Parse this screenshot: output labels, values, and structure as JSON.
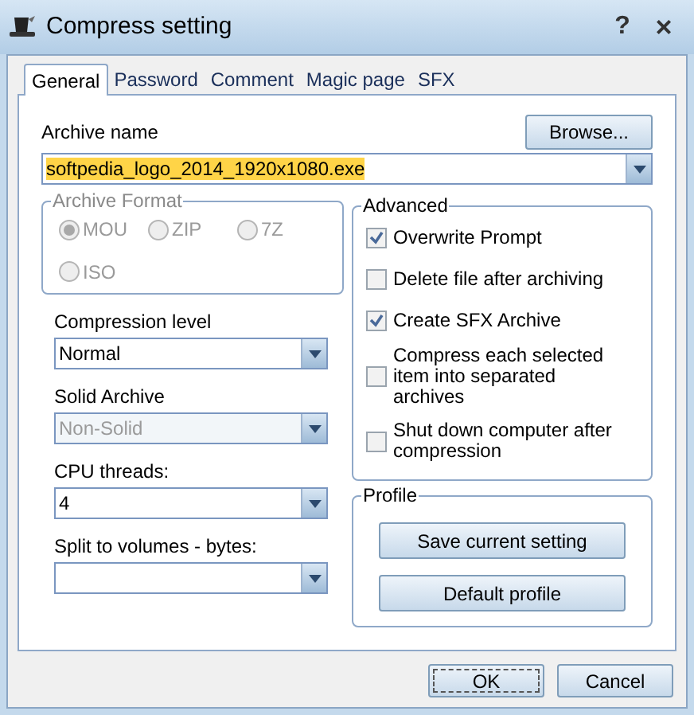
{
  "window": {
    "title": "Compress setting",
    "help": "?",
    "close": "×"
  },
  "tabs": [
    {
      "label": "General",
      "selected": true
    },
    {
      "label": "Password",
      "selected": false
    },
    {
      "label": "Comment",
      "selected": false
    },
    {
      "label": "Magic page",
      "selected": false
    },
    {
      "label": "SFX",
      "selected": false
    }
  ],
  "archive_name": {
    "label": "Archive name",
    "value": "softpedia_logo_2014_1920x1080.exe",
    "browse": "Browse..."
  },
  "archive_format": {
    "title": "Archive Format",
    "disabled": true,
    "options": [
      {
        "label": "MOU",
        "selected": true
      },
      {
        "label": "ZIP",
        "selected": false
      },
      {
        "label": "7Z",
        "selected": false
      },
      {
        "label": "ISO",
        "selected": false
      }
    ]
  },
  "settings": [
    {
      "label": "Compression level",
      "value": "Normal",
      "disabled": false
    },
    {
      "label": "Solid Archive",
      "value": "Non-Solid",
      "disabled": true
    },
    {
      "label": "CPU threads:",
      "value": "4",
      "disabled": false
    },
    {
      "label": "Split to volumes - bytes:",
      "disabled": false
    }
  ],
  "advanced": {
    "title": "Advanced",
    "options": [
      {
        "label": "Overwrite Prompt",
        "checked": true
      },
      {
        "label": "Delete file after archiving",
        "checked": false
      },
      {
        "label": "Create SFX Archive",
        "checked": true
      },
      {
        "label": "Compress each selected item into separated archives",
        "checked": false
      },
      {
        "label": "Shut down computer after compression",
        "checked": false
      }
    ]
  },
  "profile": {
    "title": "Profile",
    "buttons": [
      "Save current setting",
      "Default profile"
    ]
  },
  "footer_buttons": [
    {
      "label": "OK",
      "focused": true
    },
    {
      "label": "Cancel",
      "focused": false
    }
  ]
}
